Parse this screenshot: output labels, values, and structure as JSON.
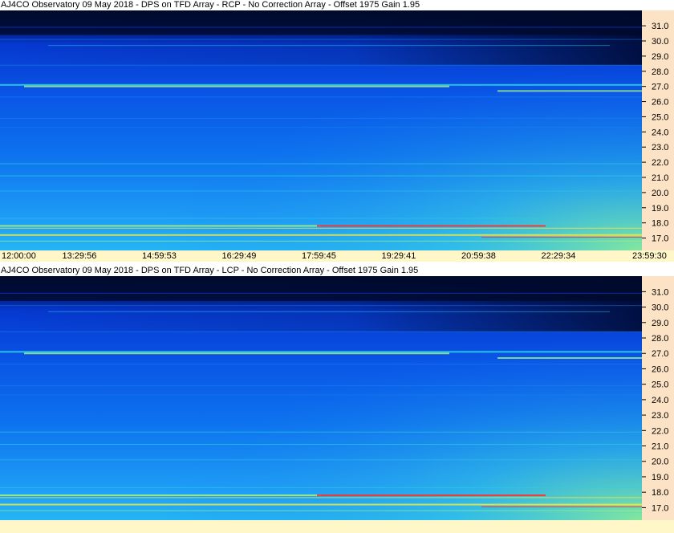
{
  "panels": [
    {
      "title": "AJ4CO Observatory 09 May 2018 - DPS on TFD Array  - RCP  -  No Correction Array  -  Offset 1975  Gain 1.95",
      "polarization": "RCP"
    },
    {
      "title": "AJ4CO Observatory 09 May 2018 - DPS on TFD Array  - LCP  -  No Correction Array  -  Offset 1975  Gain 1.95",
      "polarization": "LCP"
    }
  ],
  "time_labels": [
    "12:00:00",
    "13:29:56",
    "14:59:53",
    "16:29:49",
    "17:59:45",
    "19:29:41",
    "20:59:38",
    "22:29:34",
    "23:59:30"
  ],
  "chart_data": {
    "type": "heatmap",
    "x": [
      "12:00:00",
      "13:29:56",
      "14:59:53",
      "16:29:49",
      "17:59:45",
      "19:29:41",
      "20:59:38",
      "22:29:34",
      "23:59:30"
    ],
    "y_ticks": [
      "31.0",
      "30.0",
      "29.0",
      "28.0",
      "27.0",
      "26.0",
      "25.0",
      "24.0",
      "23.0",
      "22.0",
      "21.0",
      "20.0",
      "19.0",
      "18.0",
      "17.0"
    ],
    "ylim": [
      16.5,
      31.8
    ],
    "colormap_colors": [
      "#00103a",
      "#0a3cd8",
      "#1a8cf5",
      "#2ad0e8",
      "#9cf08a",
      "#f2e640",
      "#ff3030",
      "#ffffff"
    ],
    "series": [
      {
        "name": "RCP"
      },
      {
        "name": "LCP"
      }
    ]
  }
}
